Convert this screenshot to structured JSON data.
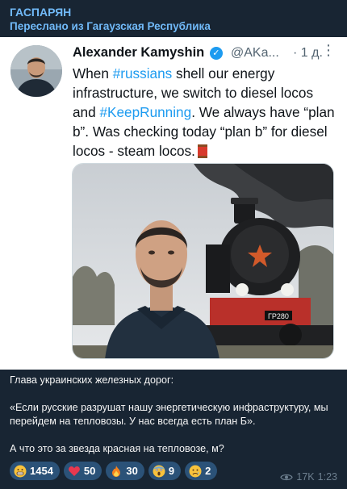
{
  "header": {
    "channel_name": "ГАСПАРЯН",
    "forwarded_label": "Переслано из Гагаузская Республика"
  },
  "tweet": {
    "author_name": "Alexander Kamyshin",
    "handle": "@AKa...",
    "time_ago": "· 1 д.",
    "more_icon": "more-dots-icon",
    "text_parts": {
      "p1": "When ",
      "tag1": "#russians",
      "p2": " shell our energy infrastructure, we switch to diesel locos and ",
      "tag2": "#KeepRunning",
      "p3": ". We always have “plan b”. Was checking today “plan b” for diesel locos - steam locos."
    },
    "locomotive_plate": "ГР280"
  },
  "caption": {
    "line1": "Глава украинских железных дорог:",
    "line2": "«Если русские разрушат нашу энергетическую инфраструктуру, мы перейдем на тепловозы. У нас всегда есть план Б».",
    "line3": "А что это за звезда красная на тепловозе, м?"
  },
  "reactions": [
    {
      "icon": "grimace-emoji-icon",
      "count": "1454"
    },
    {
      "icon": "heart-emoji-icon",
      "count": "50"
    },
    {
      "icon": "fire-emoji-icon",
      "count": "30"
    },
    {
      "icon": "scream-emoji-icon",
      "count": "9"
    },
    {
      "icon": "sad-emoji-icon",
      "count": "2"
    }
  ],
  "meta": {
    "views": "17K",
    "time": "1:23",
    "views_icon": "eye-icon"
  },
  "colors": {
    "background": "#182533",
    "link": "#71baf9",
    "reaction_bg": "#2b5278",
    "tweet_link": "#1d9bf0"
  }
}
